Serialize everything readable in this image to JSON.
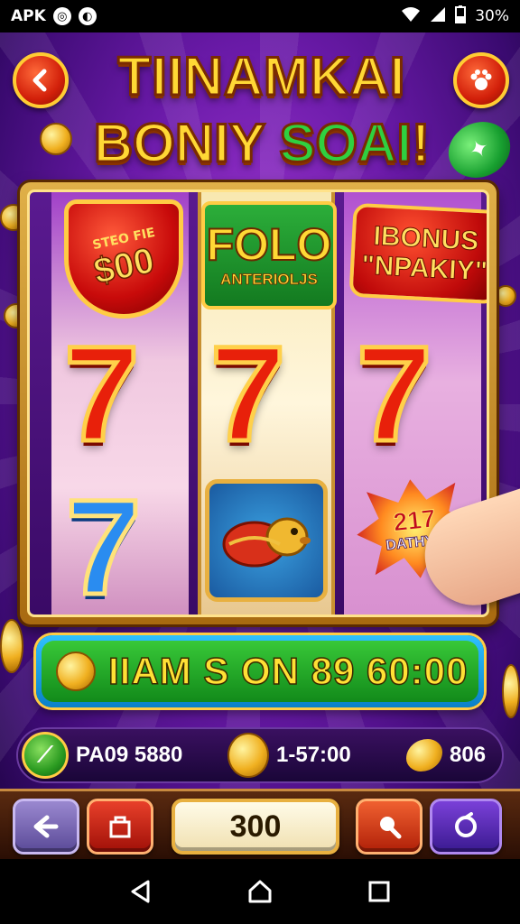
{
  "status_bar": {
    "app_label": "APK",
    "notif_icons": [
      "notification-icon",
      "vpn-icon"
    ],
    "battery": "30%"
  },
  "header": {
    "title_line1": "TIINAMKAI",
    "title_line2_part1": "BONIY",
    "title_line2_part2": "SOAI",
    "title_line2_part3": "!"
  },
  "reels": {
    "shield_top": "STEO FIE",
    "shield_value": "$00",
    "folo_title": "FOLO",
    "folo_sub": "ANTERIOLJS",
    "bonus_line1": "IBONUS",
    "bonus_line2": "\"NPAKIY\"",
    "burst_line1": "217",
    "burst_line2": "DATHYAI",
    "sevens": [
      "7",
      "7",
      "7",
      "7"
    ]
  },
  "win_banner": {
    "text": "IIAM S ON 89 60:00"
  },
  "info_bar": {
    "item1": "PA09 5880",
    "item2": "1-57:00",
    "item3": "806"
  },
  "controls": {
    "bet_value": "300"
  },
  "colors": {
    "gold": "#ffd835",
    "green": "#2fd040",
    "red": "#e8200a",
    "purple": "#6a1aa8"
  }
}
